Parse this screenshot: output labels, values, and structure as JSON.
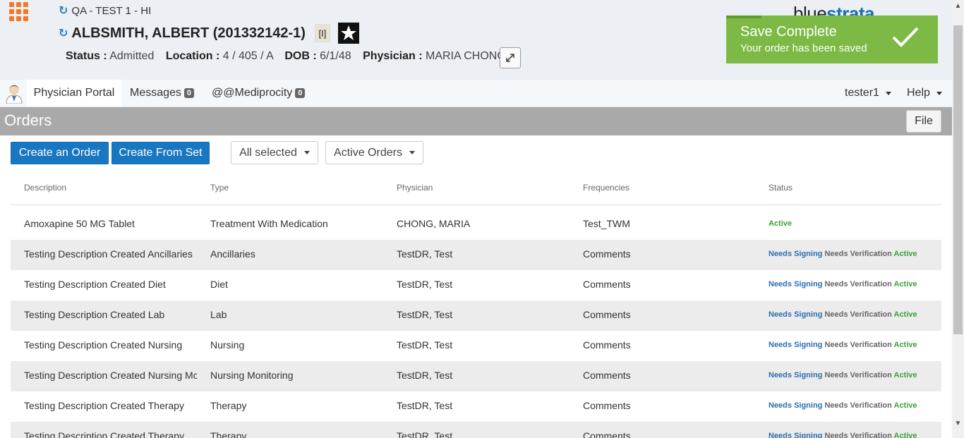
{
  "header": {
    "facility": "QA - TEST 1 - HI",
    "patient_name": "ALBSMITH, ALBERT (201332142-1)",
    "flag": "[I]",
    "status_label": "Status :",
    "status_value": "Admitted",
    "location_label": "Location :",
    "location_value": "4 / 405 / A",
    "dob_label": "DOB :",
    "dob_value": "6/1/48",
    "physician_label": "Physician :",
    "physician_value": "MARIA CHONG",
    "logo_light": "blue",
    "logo_bold": "strata"
  },
  "toast": {
    "title": "Save Complete",
    "message": "Your order has been saved"
  },
  "nav": {
    "portal": "Physician Portal",
    "messages": "Messages",
    "messages_count": "0",
    "mediprocity": "@@Mediprocity",
    "mediprocity_count": "0",
    "user": "tester1",
    "help": "Help"
  },
  "orders": {
    "title": "Orders",
    "file_button": "File",
    "create_order": "Create an Order",
    "create_from_set": "Create From Set",
    "filter_selected": "All selected",
    "filter_orders": "Active Orders"
  },
  "table": {
    "columns": [
      "Description",
      "Type",
      "Physician",
      "Frequencies",
      "Status"
    ],
    "rows": [
      {
        "description": "Amoxapine 50 MG Tablet",
        "type": "Treatment With Medication",
        "physician": "CHONG, MARIA",
        "frequency": "Test_TWM",
        "needs_signing": "",
        "needs_verification": "",
        "active": "Active"
      },
      {
        "description": "Testing Description Created Ancillaries",
        "type": "Ancillaries",
        "physician": "TestDR, Test",
        "frequency": "Comments",
        "needs_signing": "Needs Signing",
        "needs_verification": "Needs Verification",
        "active": "Active"
      },
      {
        "description": "Testing Description Created Diet",
        "type": "Diet",
        "physician": "TestDR, Test",
        "frequency": "Comments",
        "needs_signing": "Needs Signing",
        "needs_verification": "Needs Verification",
        "active": "Active"
      },
      {
        "description": "Testing Description Created Lab",
        "type": "Lab",
        "physician": "TestDR, Test",
        "frequency": "Comments",
        "needs_signing": "Needs Signing",
        "needs_verification": "Needs Verification",
        "active": "Active"
      },
      {
        "description": "Testing Description Created Nursing",
        "type": "Nursing",
        "physician": "TestDR, Test",
        "frequency": "Comments",
        "needs_signing": "Needs Signing",
        "needs_verification": "Needs Verification",
        "active": "Active"
      },
      {
        "description": "Testing Description Created Nursing Mc",
        "type": "Nursing Monitoring",
        "physician": "TestDR, Test",
        "frequency": "Comments",
        "needs_signing": "Needs Signing",
        "needs_verification": "Needs Verification",
        "active": "Active"
      },
      {
        "description": "Testing Description Created Therapy",
        "type": "Therapy",
        "physician": "TestDR, Test",
        "frequency": "Comments",
        "needs_signing": "Needs Signing",
        "needs_verification": "Needs Verification",
        "active": "Active"
      },
      {
        "description": "Testing Description Created Therapy",
        "type": "Therapy",
        "physician": "TestDR, Test",
        "frequency": "Comments",
        "needs_signing": "Needs Signing",
        "needs_verification": "Needs Verification",
        "active": "Active"
      }
    ]
  },
  "colors": {
    "accent": "#1976c0",
    "toast": "#7cba45",
    "app_grid": "#f07a2a",
    "status_active": "#3aa336",
    "status_signing": "#2a6fb0"
  }
}
